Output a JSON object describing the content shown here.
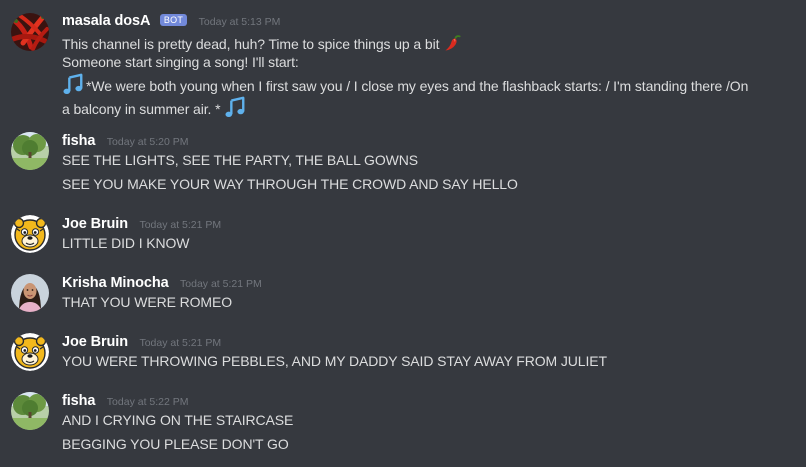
{
  "messages": [
    {
      "author": "masala dosA",
      "bot_badge": "BOT",
      "timestamp": "Today at 5:13 PM",
      "avatar_icon": "red-chili-peppers-avatar",
      "lines": [
        "This channel is pretty dead, huh? Time to spice things up a bit",
        " Someone start singing a song! I'll start:",
        "*We were both young when I first saw you / I close my eyes and the flashback starts: / I'm standing there /On",
        "a balcony in summer air. *"
      ]
    },
    {
      "author": "fisha",
      "timestamp": "Today at 5:20 PM",
      "avatar_icon": "park-tree-avatar",
      "lines": [
        "SEE THE LIGHTS, SEE THE PARTY, THE BALL GOWNS",
        "SEE YOU MAKE YOUR WAY THROUGH THE CROWD AND SAY HELLO"
      ]
    },
    {
      "author": "Joe Bruin",
      "timestamp": "Today at 5:21 PM",
      "avatar_icon": "bruin-bear-avatar",
      "lines": [
        "LITTLE DID I KNOW"
      ]
    },
    {
      "author": "Krisha Minocha",
      "timestamp": "Today at 5:21 PM",
      "avatar_icon": "person-photo-avatar",
      "lines": [
        "THAT YOU WERE ROMEO"
      ]
    },
    {
      "author": "Joe Bruin",
      "timestamp": "Today at 5:21 PM",
      "avatar_icon": "bruin-bear-avatar",
      "lines": [
        "YOU WERE THROWING PEBBLES, AND MY DADDY SAID STAY AWAY FROM JULIET"
      ]
    },
    {
      "author": "fisha",
      "timestamp": "Today at 5:22 PM",
      "avatar_icon": "park-tree-avatar",
      "lines": [
        "AND I CRYING ON THE STAIRCASE",
        "BEGGING YOU PLEASE DON'T GO"
      ]
    }
  ],
  "emoji_icons": [
    "hot-pepper-emoji",
    "musical-notes-emoji"
  ],
  "colors": {
    "background": "#36393f",
    "username": "#ffffff",
    "message_text": "#dcddde",
    "timestamp": "#72767d",
    "bot_badge": "#7289da",
    "music_note": "#5fb1ec",
    "pepper": "#d92b1f"
  }
}
